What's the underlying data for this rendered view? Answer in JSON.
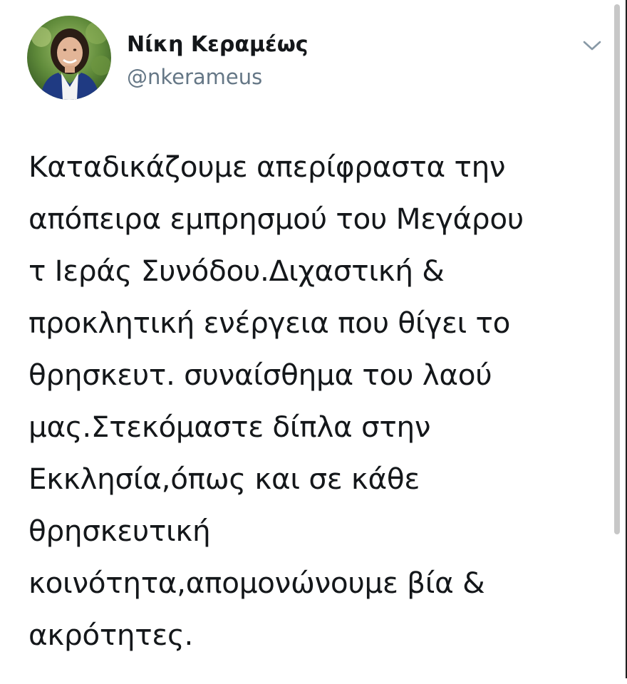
{
  "tweet": {
    "display_name": "Νίκη Κεραμέως",
    "handle": "@nkerameus",
    "lines": [
      "Καταδικάζουμε απερίφραστα την",
      "απόπειρα εμπρησμού του Μεγάρου",
      "τ Ιεράς Συνόδου.Διχαστική &",
      "προκλητική ενέργεια που θίγει το",
      "θρησκευτ. συναίσθημα του λαού",
      "μας.Στεκόμαστε δίπλα στην",
      "Εκκλησία,όπως και σε κάθε",
      "θρησκευτική",
      "κοινότητα,απομονώνουμε βία &",
      "ακρότητες."
    ]
  },
  "icons": {
    "more_options": "chevron-down-icon",
    "avatar": "profile-photo"
  },
  "colors": {
    "text": "#14171a",
    "handle": "#657786",
    "chevron": "#8899a6"
  }
}
